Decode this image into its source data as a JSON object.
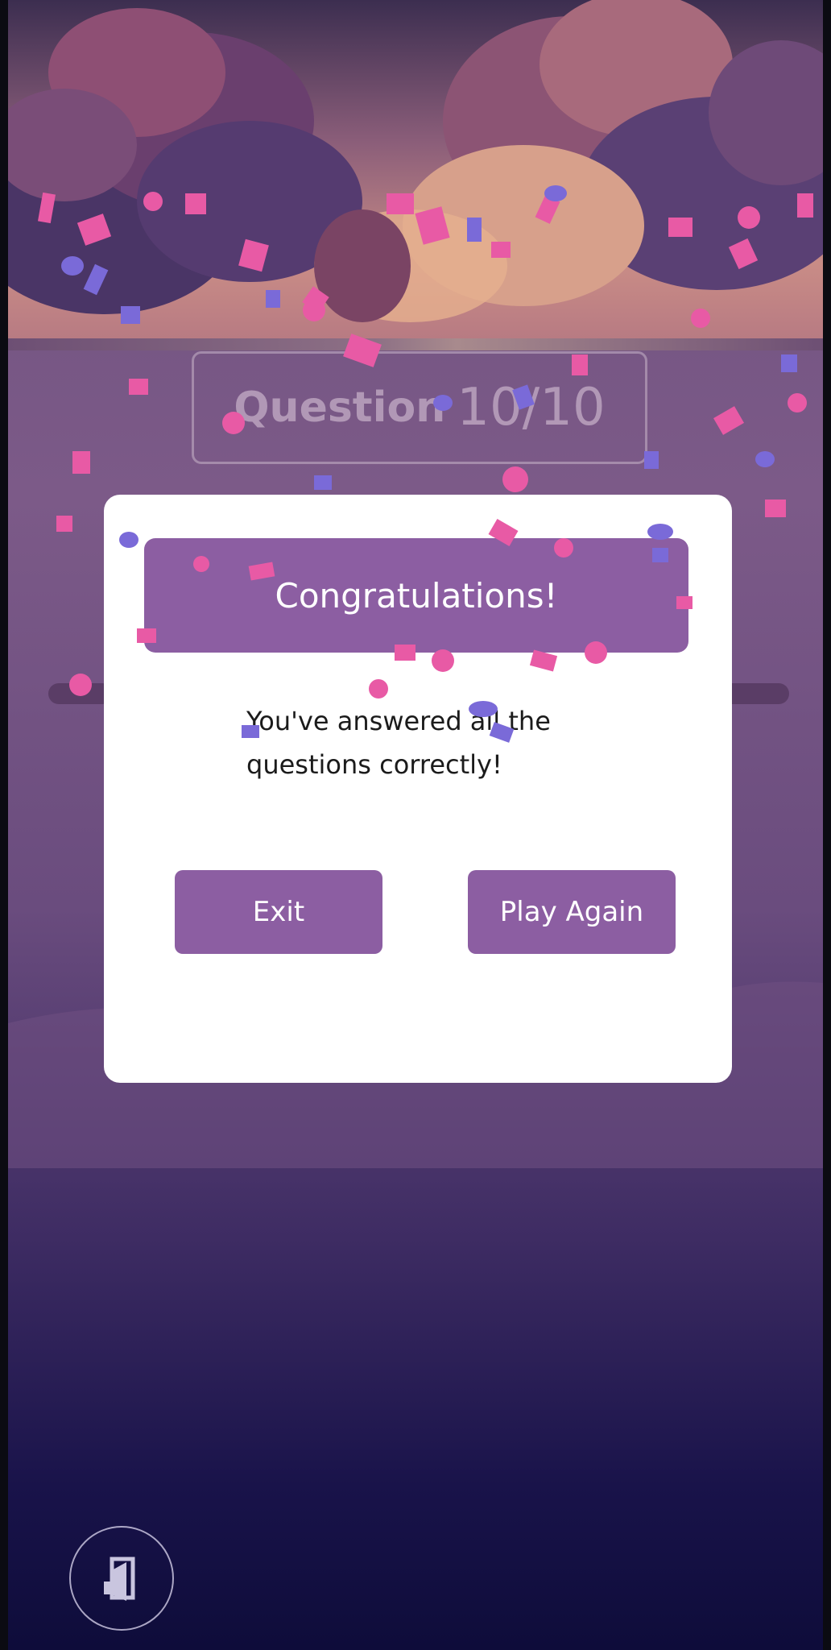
{
  "quiz": {
    "question_label": "Question",
    "question_progress": "10/10"
  },
  "dialog": {
    "title": "Congratulations!",
    "message": "You've answered all the questions correctly!",
    "exit_label": "Exit",
    "play_again_label": "Play Again"
  },
  "icons": {
    "exit_fab": "exit-door-icon"
  },
  "colors": {
    "accent": "#8c5ea2",
    "dialog_bg": "#ffffff",
    "confetti_pink": "#e85aa5",
    "confetti_violet": "#7a6ad8"
  }
}
